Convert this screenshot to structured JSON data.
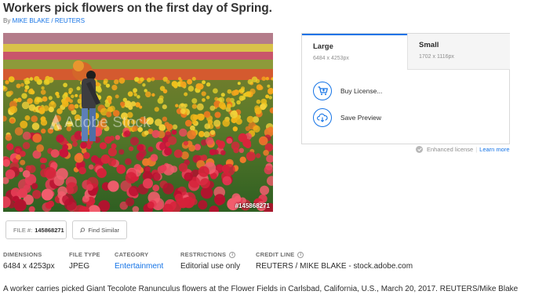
{
  "title": "Workers pick flowers on the first day of Spring.",
  "byline": {
    "prefix": "By",
    "author": "MIKE BLAKE / REUTERS"
  },
  "image": {
    "file_id": "#145868271",
    "watermark": "Adobe Stock"
  },
  "license_panel": {
    "tabs": [
      {
        "name": "Large",
        "dimensions": "6484 x 4253px",
        "selected": true
      },
      {
        "name": "Small",
        "dimensions": "1702 x 1116px",
        "selected": false
      }
    ],
    "actions": [
      {
        "label": "Buy License...",
        "icon": "cart-icon"
      },
      {
        "label": "Save Preview",
        "icon": "cloud-download-icon"
      }
    ]
  },
  "license_note": {
    "enhanced": "Enhanced license",
    "learn_more": "Learn more"
  },
  "buttons": {
    "file_label": "FILE #:",
    "file_value": "145868271",
    "find_similar": "Find Similar"
  },
  "metadata": [
    {
      "key": "DIMENSIONS",
      "value": "6484 x 4253px",
      "info": false,
      "link": false
    },
    {
      "key": "FILE TYPE",
      "value": "JPEG",
      "info": false,
      "link": false
    },
    {
      "key": "CATEGORY",
      "value": "Entertainment",
      "info": false,
      "link": true
    },
    {
      "key": "RESTRICTIONS",
      "value": "Editorial use only",
      "info": true,
      "link": false
    },
    {
      "key": "CREDIT LINE",
      "value": "REUTERS / MIKE BLAKE - stock.adobe.com",
      "info": true,
      "link": false
    }
  ],
  "caption": "A worker carries picked Giant Tecolote Ranunculus flowers at the Flower Fields in Carlsbad, California, U.S., March 20, 2017. REUTERS/Mike Blake",
  "colors": {
    "accent": "#1473e6",
    "muted": "#6e6e6e"
  }
}
